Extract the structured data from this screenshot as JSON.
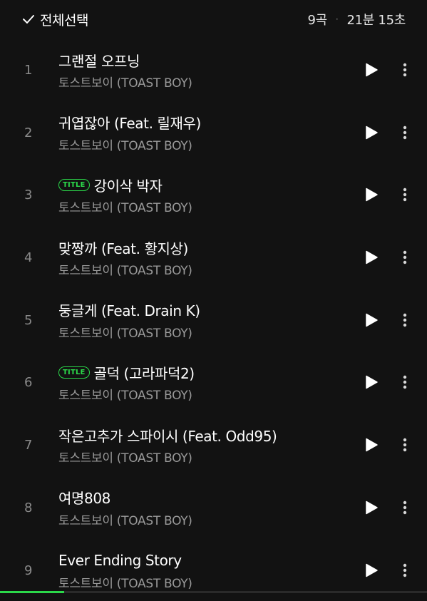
{
  "header": {
    "select_all_label": "전체선택",
    "track_count": "9곡",
    "separator": "·",
    "total_duration": "21분 15초"
  },
  "tracks": [
    {
      "number": "1",
      "title": "그랜절 오프닝",
      "artist": "토스트보이 (TOAST BOY)",
      "badge": ""
    },
    {
      "number": "2",
      "title": "귀엽잖아 (Feat. 릴재우)",
      "artist": "토스트보이 (TOAST BOY)",
      "badge": ""
    },
    {
      "number": "3",
      "title": "강이삭 박자",
      "artist": "토스트보이 (TOAST BOY)",
      "badge": "TITLE"
    },
    {
      "number": "4",
      "title": "맞짱까 (Feat. 황지상)",
      "artist": "토스트보이 (TOAST BOY)",
      "badge": ""
    },
    {
      "number": "5",
      "title": "둥글게 (Feat. Drain K)",
      "artist": "토스트보이 (TOAST BOY)",
      "badge": ""
    },
    {
      "number": "6",
      "title": "골덕 (고라파덕2)",
      "artist": "토스트보이 (TOAST BOY)",
      "badge": "TITLE"
    },
    {
      "number": "7",
      "title": "작은고추가 스파이시 (Feat. Odd95)",
      "artist": "토스트보이 (TOAST BOY)",
      "badge": ""
    },
    {
      "number": "8",
      "title": "여명808",
      "artist": "토스트보이 (TOAST BOY)",
      "badge": ""
    },
    {
      "number": "9",
      "title": "Ever Ending Story",
      "artist": "토스트보이 (TOAST BOY)",
      "badge": ""
    }
  ],
  "playback_progress": 0.15,
  "colors": {
    "background": "#121212",
    "accent": "#2bd84a",
    "text_primary": "#ffffff",
    "text_secondary": "#9a9a9a"
  },
  "icons": {
    "select_all": "check-icon",
    "play": "play-icon",
    "more": "more-vertical-icon"
  }
}
